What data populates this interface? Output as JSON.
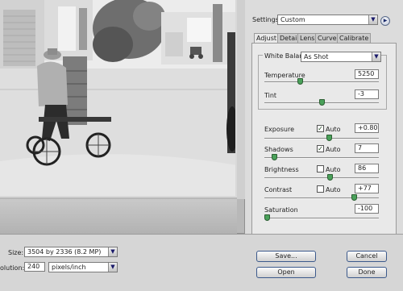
{
  "settings": {
    "label": "Settings:",
    "value": "Custom"
  },
  "tabs": [
    {
      "label": "Adjust",
      "active": true
    },
    {
      "label": "Detail",
      "active": false
    },
    {
      "label": "Lens",
      "active": false
    },
    {
      "label": "Curve",
      "active": false
    },
    {
      "label": "Calibrate",
      "active": false
    }
  ],
  "white_balance": {
    "label": "White Balance:",
    "value": "As Shot"
  },
  "controls": {
    "temperature": {
      "label": "Temperature",
      "value": "5250",
      "level": 0.3
    },
    "tint": {
      "label": "Tint",
      "value": "-3",
      "level": 0.5
    },
    "exposure": {
      "label": "Exposure",
      "auto_label": "Auto",
      "auto_checked": true,
      "value": "+0.80",
      "level": 0.57
    },
    "shadows": {
      "label": "Shadows",
      "auto_label": "Auto",
      "auto_checked": true,
      "value": "7",
      "level": 0.07
    },
    "brightness": {
      "label": "Brightness",
      "auto_label": "Auto",
      "auto_checked": false,
      "value": "86",
      "level": 0.58
    },
    "contrast": {
      "label": "Contrast",
      "auto_label": "Auto",
      "auto_checked": false,
      "value": "+77",
      "level": 0.8
    },
    "saturation": {
      "label": "Saturation",
      "value": "-100",
      "level": 0.0
    }
  },
  "size": {
    "label": "Size:",
    "value": "3504 by 2336  (8.2 MP)"
  },
  "resolution": {
    "label": "olution:",
    "value": "240",
    "unit": "pixels/inch"
  },
  "buttons": {
    "save": "Save...",
    "cancel": "Cancel",
    "open": "Open",
    "done": "Done"
  },
  "colors": {
    "accent_slider": "#4aa15a",
    "button_border": "#3c5a8c"
  }
}
